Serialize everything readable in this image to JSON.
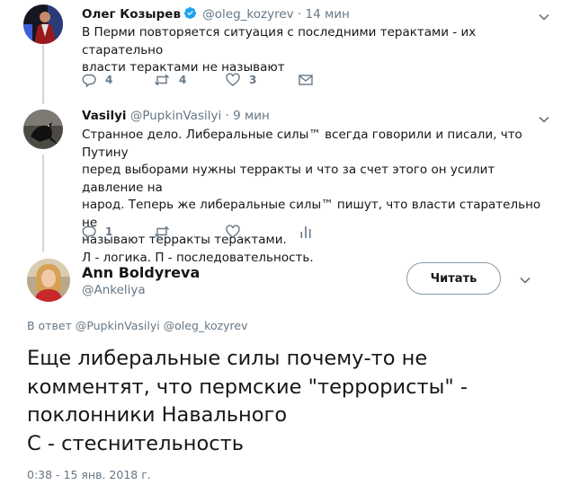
{
  "tweet1": {
    "name": "Олег Козырев",
    "handle": "@oleg_kozyrev",
    "separator": "·",
    "time": "14 мин",
    "text_lines": [
      "В Перми повторяется ситуация с последними терактами - их старательно",
      "власти терактами не называют"
    ],
    "replies": "4",
    "retweets": "4",
    "likes": "3",
    "verified": true
  },
  "tweet2": {
    "name": "Vasilyi",
    "handle": "@PupkinVasilyi",
    "separator": "·",
    "time": "9 мин",
    "text_lines": [
      "Странное дело. Либеральные силы™ всегда говорили и писали, что Путину",
      "перед выборами нужны терракты и что за счет этого он усилит давление на",
      "народ. Теперь же либеральные силы™ пишут, что власти старательно не",
      "называют терракты терактами.",
      "Л - логика. П - последовательность."
    ],
    "replies": "1"
  },
  "main": {
    "name": "Ann Boldyreva",
    "handle": "@Ankeliya",
    "follow_label": "Читать",
    "reply_prefix": "В ответ",
    "reply_mentions": "@PupkinVasilyi @oleg_kozyrev",
    "text_lines": [
      "Еще либеральные силы почему-то не",
      "комментят, что пермские \"террористы\" -",
      "поклонники Навального",
      "С - стеснительность"
    ],
    "timestamp": "0:38 - 15 янв. 2018 г."
  },
  "icons": {
    "reply": "reply-icon",
    "retweet": "retweet-icon",
    "like": "heart-icon",
    "dm": "envelope-icon",
    "analytics": "analytics-icon",
    "more": "chevron-down-icon",
    "verified": "verified-badge-icon"
  },
  "colors": {
    "icon_gray": "#657786",
    "verified_blue": "#1da1f2",
    "thread_line": "#ccd6dd"
  }
}
